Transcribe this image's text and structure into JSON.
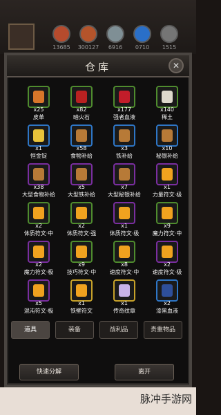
{
  "hud": {
    "resources": [
      {
        "value": "13685",
        "color": "#b64b2d",
        "icon": "ore-icon"
      },
      {
        "value": "300127",
        "color": "#b4542b",
        "icon": "wood-icon"
      },
      {
        "value": "6916",
        "color": "#7f8f95",
        "icon": "stone-icon"
      },
      {
        "value": "0710",
        "color": "#2a6fc8",
        "icon": "crystal-icon"
      },
      {
        "value": "1515",
        "color": "#757575",
        "icon": "iron-icon"
      }
    ]
  },
  "window": {
    "title": "仓库",
    "close_label": "✕"
  },
  "items": [
    {
      "qty": "x25",
      "name": "皮革",
      "color": "#d8762a",
      "border": "#4f8c2e"
    },
    {
      "qty": "x82",
      "name": "暗火石",
      "color": "#b82121",
      "border": "#4f8c2e"
    },
    {
      "qty": "x177",
      "name": "强者血液",
      "color": "#c21d2a",
      "border": "#4f8c2e"
    },
    {
      "qty": "x140",
      "name": "稀土",
      "color": "#ddd8cc",
      "border": "#4f8c2e"
    },
    {
      "qty": "x1",
      "name": "恒金锭",
      "color": "#e8c23a",
      "border": "#2e76c6"
    },
    {
      "qty": "x58",
      "name": "食物补给",
      "color": "#b77a37",
      "border": "#2e76c6"
    },
    {
      "qty": "x3",
      "name": "铁补给",
      "color": "#b77a37",
      "border": "#2e76c6"
    },
    {
      "qty": "x10",
      "name": "秘银补给",
      "color": "#b77a37",
      "border": "#2e76c6"
    },
    {
      "qty": "x38",
      "name": "大型食物补给",
      "color": "#b77a37",
      "border": "#7a2ea0"
    },
    {
      "qty": "x5",
      "name": "大型铁补给",
      "color": "#b77a37",
      "border": "#7a2ea0"
    },
    {
      "qty": "x7",
      "name": "大型秘银补给",
      "color": "#b77a37",
      "border": "#7a2ea0"
    },
    {
      "qty": "x1",
      "name": "力量符文·极",
      "color": "#f0a21f",
      "border": "#7a2ea0"
    },
    {
      "qty": "x2",
      "name": "体质符文·中",
      "color": "#f0a21f",
      "border": "#4f8c2e"
    },
    {
      "qty": "x2",
      "name": "体质符文·强",
      "color": "#f0a21f",
      "border": "#4f8c2e"
    },
    {
      "qty": "x1",
      "name": "体质符文·极",
      "color": "#f0a21f",
      "border": "#7a2ea0"
    },
    {
      "qty": "x9",
      "name": "魔力符文·中",
      "color": "#f0a21f",
      "border": "#4f8c2e"
    },
    {
      "qty": "x2",
      "name": "魔力符文·极",
      "color": "#f0a21f",
      "border": "#7a2ea0"
    },
    {
      "qty": "x9",
      "name": "技巧符文·中",
      "color": "#f0a21f",
      "border": "#4f8c2e"
    },
    {
      "qty": "x8",
      "name": "速度符文·中",
      "color": "#f0a21f",
      "border": "#4f8c2e"
    },
    {
      "qty": "x2",
      "name": "速度符文·极",
      "color": "#f0a21f",
      "border": "#7a2ea0"
    },
    {
      "qty": "x5",
      "name": "混沌符文·极",
      "color": "#f0a21f",
      "border": "#7a2ea0"
    },
    {
      "qty": "x1",
      "name": "铁壁符文",
      "color": "#f0a21f",
      "border": "#c7a22a"
    },
    {
      "qty": "x1",
      "name": "传奇纹章",
      "color": "#c7b2e8",
      "border": "#c7a22a"
    },
    {
      "qty": "x2",
      "name": "漆黑血液",
      "color": "#2e4f9a",
      "border": "#2e76c6"
    }
  ],
  "tabs": [
    {
      "label": "道具"
    },
    {
      "label": "装备"
    },
    {
      "label": "战利品"
    },
    {
      "label": "贵重物品"
    }
  ],
  "buttons": {
    "decompose_label": "快速分解",
    "leave_label": "离开"
  },
  "watermark": {
    "text": "脉冲手游网"
  }
}
